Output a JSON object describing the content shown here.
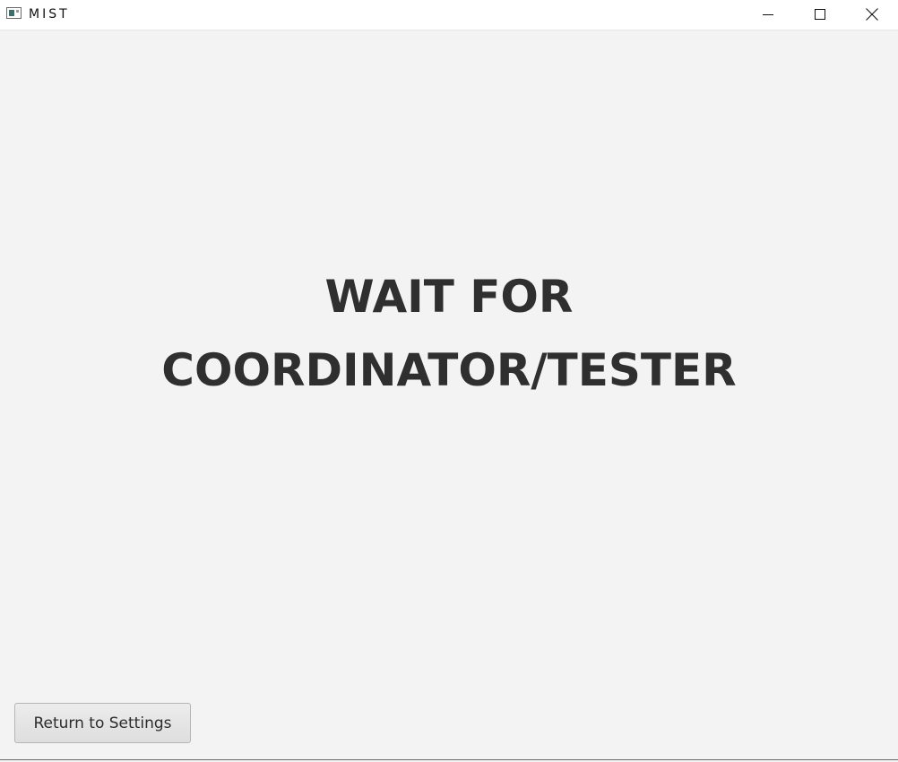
{
  "window": {
    "title": "MIST"
  },
  "controls": {
    "minimize_icon": "minimize-icon",
    "maximize_icon": "maximize-icon",
    "close_icon": "close-icon"
  },
  "main": {
    "message_line1": "WAIT FOR",
    "message_line2": "COORDINATOR/TESTER"
  },
  "footer": {
    "return_label": "Return to Settings"
  },
  "colors": {
    "background": "#f3f3f3",
    "titlebar": "#ffffff",
    "message_text": "#2f2f2f"
  }
}
